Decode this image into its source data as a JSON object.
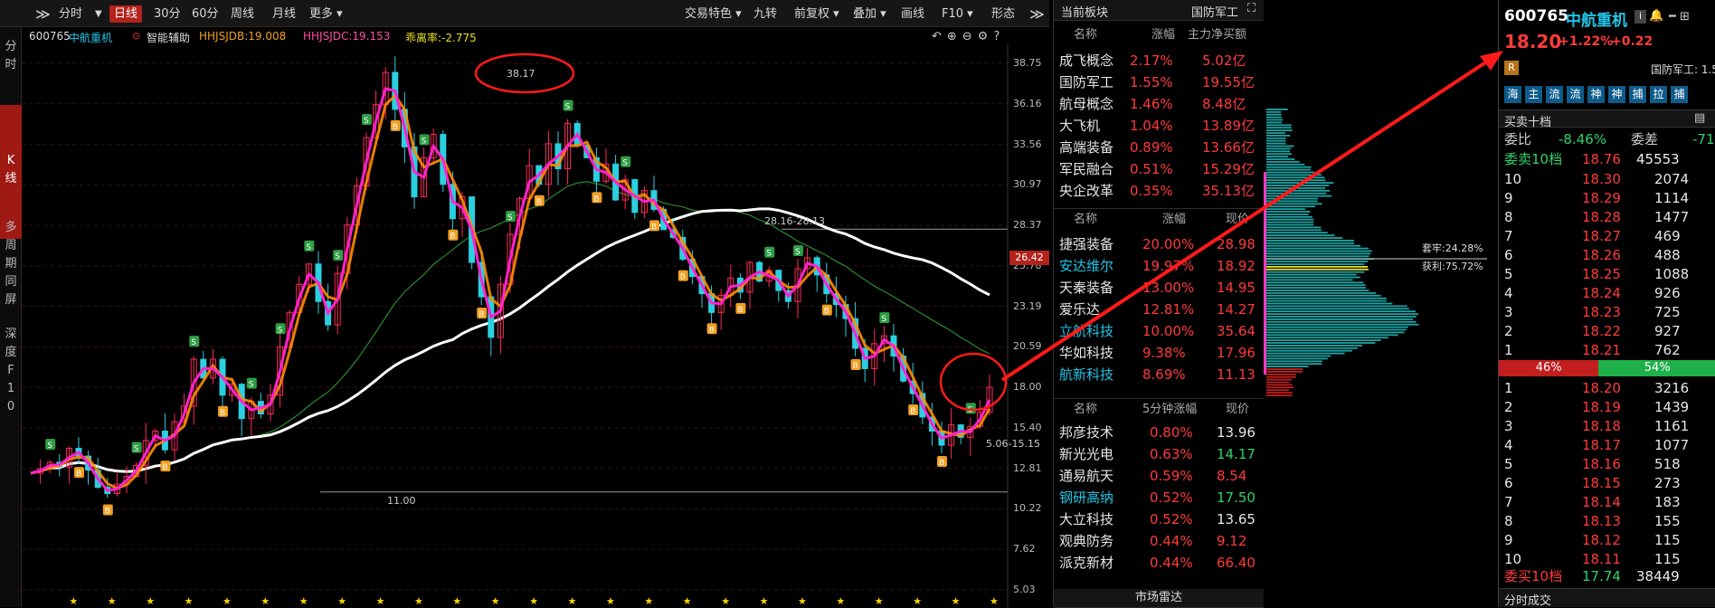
{
  "toolbar": {
    "expand": "≫",
    "periods": [
      "分时",
      "日线",
      "30分",
      "60分",
      "周线",
      "月线",
      "更多"
    ],
    "active_period": "日线",
    "tools": [
      "交易特色",
      "九转",
      "前复权",
      "叠加",
      "画线",
      "F10",
      "形态"
    ]
  },
  "side_tabs": [
    "分时",
    "K线",
    "多周期同屏",
    "深度F10"
  ],
  "indicator_bar": {
    "code": "600765",
    "name": "中航重机",
    "assist": "智能辅助",
    "hhjsjdb": "HHJSJDB:19.008",
    "hhjsjdc": "HHJSJDC:19.153",
    "deviation": "乖离率:-2.775"
  },
  "chart_data": {
    "type": "candlestick",
    "y_ticks": [
      "38.75",
      "36.16",
      "33.56",
      "30.97",
      "28.37",
      "25.78",
      "23.19",
      "20.59",
      "18.00",
      "15.40",
      "12.81",
      "10.22",
      "7.62",
      "5.03"
    ],
    "ylim": [
      5.03,
      38.75
    ],
    "current_price": "26.42",
    "annotations": [
      "38.17",
      "28.16-28.13",
      "5.06-15.15",
      "11.00"
    ],
    "chip_labels": [
      "套牢:24.28%",
      "获利:75.72%"
    ],
    "path": [
      12.5,
      12.8,
      13.2,
      12.9,
      14.1,
      13.6,
      12.7,
      11.6,
      11.2,
      11.8,
      12.3,
      13.0,
      14.6,
      15.2,
      14.0,
      15.8,
      16.8,
      19.8,
      18.6,
      19.8,
      17.5,
      18.2,
      16.0,
      17.1,
      16.3,
      17.5,
      20.6,
      22.8,
      24.6,
      25.9,
      23.5,
      22.0,
      25.3,
      28.4,
      30.9,
      34.0,
      36.1,
      38.17,
      35.8,
      33.4,
      30.2,
      32.7,
      34.2,
      31.0,
      28.8,
      30.2,
      26.0,
      23.8,
      21.2,
      24.6,
      27.8,
      30.1,
      32.2,
      31.0,
      33.6,
      32.0,
      34.9,
      33.5,
      32.7,
      31.2,
      32.3,
      30.0,
      31.3,
      29.2,
      30.6,
      29.4,
      28.1,
      27.6,
      26.2,
      25.1,
      24.0,
      22.8,
      23.9,
      25.0,
      24.1,
      26.0,
      24.8,
      25.5,
      24.2,
      23.5,
      25.6,
      26.3,
      25.2,
      24.0,
      23.3,
      22.4,
      20.5,
      19.2,
      20.8,
      21.3,
      20.0,
      18.4,
      17.6,
      16.1,
      15.2,
      14.3,
      15.6,
      14.8,
      15.5,
      16.4,
      18.0
    ]
  },
  "sector": {
    "title": "当前板块",
    "tag": "国防军工",
    "headers": [
      "名称",
      "涨幅",
      "主力净买额"
    ],
    "rows": [
      [
        "成飞概念",
        "2.17%",
        "5.02亿"
      ],
      [
        "国防军工",
        "1.55%",
        "19.55亿"
      ],
      [
        "航母概念",
        "1.46%",
        "8.48亿"
      ],
      [
        "大飞机",
        "1.04%",
        "13.89亿"
      ],
      [
        "高端装备",
        "0.89%",
        "13.66亿"
      ],
      [
        "军民融合",
        "0.51%",
        "15.29亿"
      ],
      [
        "央企改革",
        "0.35%",
        "35.13亿"
      ]
    ]
  },
  "gainers": {
    "headers": [
      "名称",
      "涨幅",
      "现价"
    ],
    "rows": [
      [
        "捷强装备",
        "20.00%",
        "28.98"
      ],
      [
        "安达维尔",
        "19.97%",
        "18.92"
      ],
      [
        "天秦装备",
        "13.00%",
        "14.95"
      ],
      [
        "爱乐达",
        "12.81%",
        "14.27"
      ],
      [
        "立航科技",
        "10.00%",
        "35.64"
      ],
      [
        "华如科技",
        "9.38%",
        "17.96"
      ],
      [
        "航新科技",
        "8.69%",
        "11.13"
      ]
    ]
  },
  "five_min": {
    "headers": [
      "名称",
      "5分钟涨幅",
      "现价"
    ],
    "rows": [
      [
        "邦彦技术",
        "0.80%",
        "13.96"
      ],
      [
        "新光光电",
        "0.63%",
        "14.17"
      ],
      [
        "通易航天",
        "0.59%",
        "8.54"
      ],
      [
        "钢研高纳",
        "0.52%",
        "17.50"
      ],
      [
        "大立科技",
        "0.52%",
        "13.65"
      ],
      [
        "观典防务",
        "0.44%",
        "9.12"
      ],
      [
        "派克新材",
        "0.44%",
        "66.40"
      ]
    ],
    "footer": "市场雷达"
  },
  "quote": {
    "code": "600765",
    "name": "中航重机",
    "price": "18.20",
    "change_pct": "+1.22%",
    "change": "+0.22",
    "badge": "R",
    "sector": "国防军工: 1.5",
    "buttons": [
      "海",
      "主",
      "流",
      "流",
      "神",
      "神",
      "捕",
      "拉",
      "捕"
    ],
    "book_title": "买卖十档",
    "webi_label": "委比",
    "webi": "-8.46%",
    "weicha_label": "委差",
    "weicha": "-71",
    "sell_total_label": "委卖10档",
    "sell_total_price": "18.76",
    "sell_total_vol": "45553",
    "asks": [
      [
        "10",
        "18.30",
        "2074"
      ],
      [
        "9",
        "18.29",
        "1114"
      ],
      [
        "8",
        "18.28",
        "1477"
      ],
      [
        "7",
        "18.27",
        "469"
      ],
      [
        "6",
        "18.26",
        "488"
      ],
      [
        "5",
        "18.25",
        "1088"
      ],
      [
        "4",
        "18.24",
        "926"
      ],
      [
        "3",
        "18.23",
        "725"
      ],
      [
        "2",
        "18.22",
        "927"
      ],
      [
        "1",
        "18.21",
        "762"
      ]
    ],
    "ratio_sell": "46%",
    "ratio_buy": "54%",
    "bids": [
      [
        "1",
        "18.20",
        "3216"
      ],
      [
        "2",
        "18.19",
        "1439"
      ],
      [
        "3",
        "18.18",
        "1161"
      ],
      [
        "4",
        "18.17",
        "1077"
      ],
      [
        "5",
        "18.16",
        "518"
      ],
      [
        "6",
        "18.15",
        "273"
      ],
      [
        "7",
        "18.14",
        "183"
      ],
      [
        "8",
        "18.13",
        "155"
      ],
      [
        "9",
        "18.12",
        "115"
      ],
      [
        "10",
        "18.11",
        "115"
      ]
    ],
    "buy_total_label": "委买10档",
    "buy_total_price": "17.74",
    "buy_total_vol": "38449",
    "bottom": "分时成交"
  }
}
